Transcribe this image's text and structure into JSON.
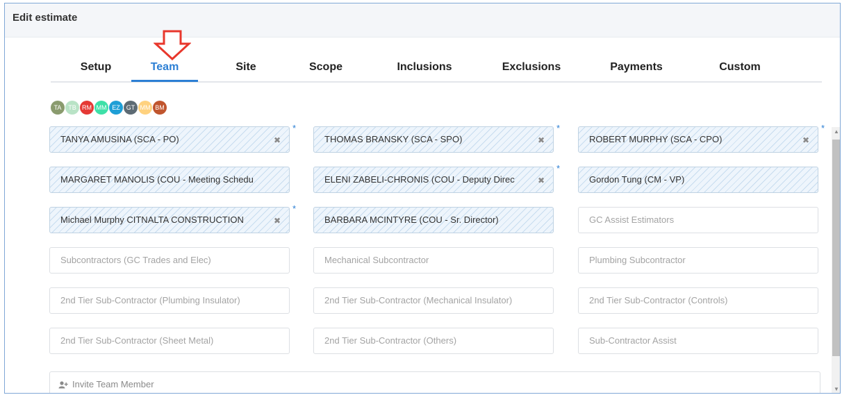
{
  "header": {
    "title": "Edit estimate"
  },
  "tabs": [
    {
      "label": "Setup"
    },
    {
      "label": "Team",
      "active": true
    },
    {
      "label": "Site"
    },
    {
      "label": "Scope"
    },
    {
      "label": "Inclusions"
    },
    {
      "label": "Exclusions"
    },
    {
      "label": "Payments"
    },
    {
      "label": "Custom"
    }
  ],
  "avatars": [
    {
      "initials": "TA",
      "color": "#8a9b6e"
    },
    {
      "initials": "TB",
      "color": "#b9e3c6"
    },
    {
      "initials": "RM",
      "color": "#e53935"
    },
    {
      "initials": "MM",
      "color": "#3ee0a8"
    },
    {
      "initials": "EZ",
      "color": "#1e9fd6"
    },
    {
      "initials": "GT",
      "color": "#5d6b74"
    },
    {
      "initials": "MM",
      "color": "#ffd27f"
    },
    {
      "initials": "BM",
      "color": "#c0552e"
    }
  ],
  "team_fields": [
    {
      "value": "TANYA AMUSINA (SCA - PO)",
      "removable": true,
      "required": true
    },
    {
      "value": "THOMAS BRANSKY (SCA - SPO)",
      "removable": true,
      "required": true
    },
    {
      "value": "ROBERT MURPHY (SCA - CPO)",
      "removable": true,
      "required": true
    },
    {
      "value": "MARGARET MANOLIS (COU - Meeting Schedu",
      "removable": false,
      "required": false
    },
    {
      "value": "ELENI ZABELI-CHRONIS (COU - Deputy Direc",
      "removable": true,
      "required": true
    },
    {
      "value": "Gordon Tung (CM - VP)",
      "removable": false,
      "required": false
    },
    {
      "value": "Michael Murphy CITNALTA CONSTRUCTION",
      "removable": true,
      "required": true
    },
    {
      "value": "BARBARA MCINTYRE (COU - Sr. Director)",
      "removable": false,
      "required": false
    },
    {
      "placeholder": "GC Assist Estimators"
    },
    {
      "placeholder": "Subcontractors (GC Trades and Elec)"
    },
    {
      "placeholder": "Mechanical Subcontractor"
    },
    {
      "placeholder": "Plumbing Subcontractor"
    },
    {
      "placeholder": "2nd Tier Sub-Contractor (Plumbing Insulator)"
    },
    {
      "placeholder": "2nd Tier Sub-Contractor (Mechanical Insulator)"
    },
    {
      "placeholder": "2nd Tier Sub-Contractor (Controls)"
    },
    {
      "placeholder": "2nd Tier Sub-Contractor (Sheet Metal)"
    },
    {
      "placeholder": "2nd Tier Sub-Contractor (Others)"
    },
    {
      "placeholder": "Sub-Contractor Assist"
    }
  ],
  "required_marker": "*",
  "remove_glyph": "✖",
  "invite": {
    "icon": "add-user-icon",
    "label": "Invite Team Member"
  },
  "colors": {
    "accent": "#2c7fd4",
    "arrow": "#e8372c",
    "filled_bg": "#eef5fc"
  }
}
